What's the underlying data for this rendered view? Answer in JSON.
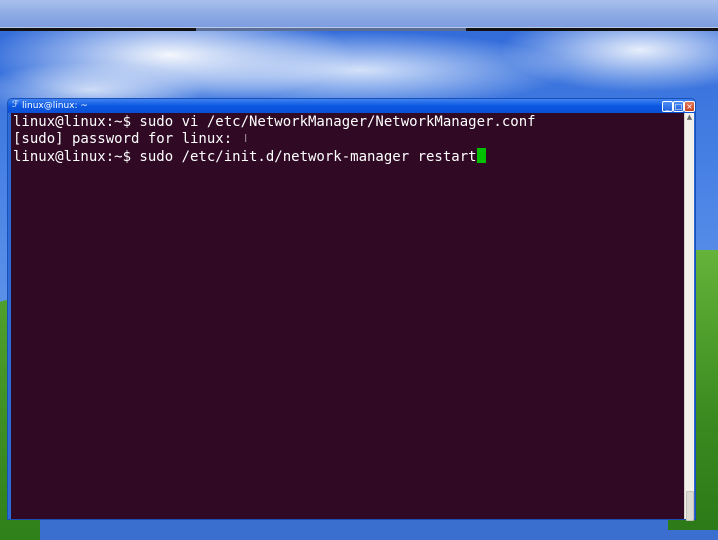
{
  "window": {
    "title": "linux@linux: ~",
    "buttons": {
      "minimize": "_",
      "maximize": "□",
      "close": "×"
    }
  },
  "terminal": {
    "lines": [
      "linux@linux:~$ sudo vi /etc/NetworkManager/NetworkManager.conf",
      "[sudo] password for linux: ",
      "linux@linux:~$ sudo /etc/init.d/network-manager restart"
    ],
    "background_color": "#300a24",
    "text_color": "#ffffff",
    "cursor_color": "#00c000"
  },
  "icons": {
    "terminal": "terminal-icon",
    "ibeam": "text-cursor-icon",
    "scroll_up": "scroll-up-arrow-icon"
  }
}
